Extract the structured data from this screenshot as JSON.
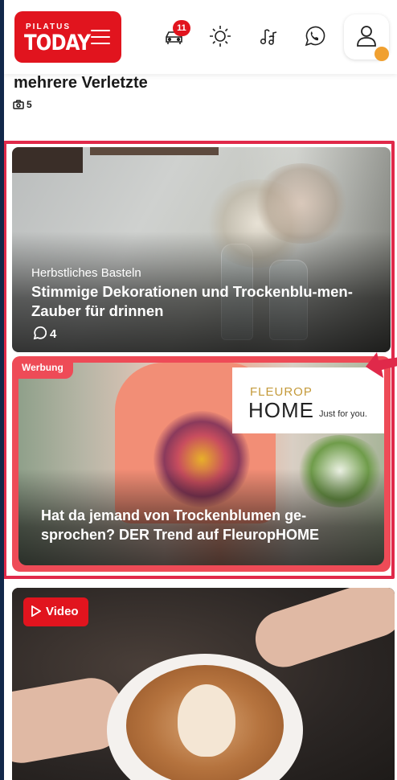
{
  "header": {
    "logo_top": "PILATUS",
    "logo_main": "TODAY",
    "notification_count": "11",
    "icons": [
      "hamburger-menu-icon",
      "traffic-car-icon",
      "weather-sun-icon",
      "music-note-icon",
      "whatsapp-icon",
      "user-profile-icon"
    ]
  },
  "previous_article": {
    "title_tail": "mehrere Verletzte",
    "photo_count": "5"
  },
  "articles": [
    {
      "kicker": "Herbstliches Basteln",
      "headline": "Stimmige Dekorationen und Trockenblu-men-Zauber für drinnen",
      "comment_count": "4"
    }
  ],
  "ad": {
    "label": "Werbung",
    "brand_top": "FLEUROP",
    "brand_main": "HOME",
    "brand_slogan": "Just for you.",
    "headline": "Hat da jemand von Trockenblumen ge-sprochen? DER Trend auf FleuropHOME"
  },
  "video_card": {
    "label": "Video"
  },
  "colors": {
    "brand_red": "#e1141e",
    "highlight": "#e0294a",
    "ad_pink": "#ee4b57",
    "avatar_dot": "#f0a030",
    "backdrop": "#12284a"
  }
}
